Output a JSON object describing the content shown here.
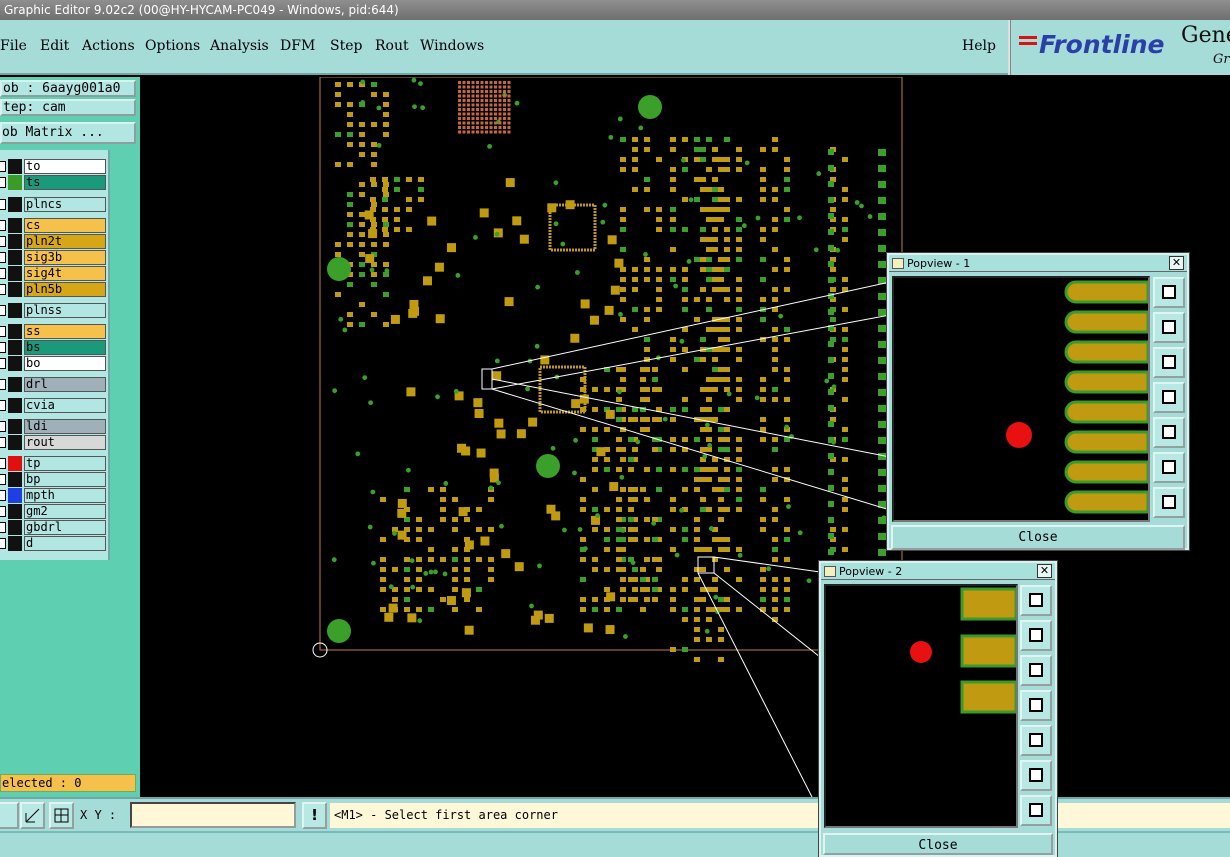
{
  "window_title": "Graphic Editor 9.02c2 (00@HY-HYCAM-PC049 - Windows, pid:644)",
  "menu": [
    "File",
    "Edit",
    "Actions",
    "Options",
    "Analysis",
    "DFM",
    "Step",
    "Rout",
    "Windows"
  ],
  "help_label": "Help",
  "brand": {
    "name": "Frontline",
    "product_line1": "Gene",
    "product_line2": "Grap"
  },
  "job_label": "ob  : 6aayg001a0",
  "step_label": "tep: cam",
  "matrix_button": "ob Matrix ...",
  "layers": [
    {
      "name": "to",
      "color": "#ffffff",
      "swatch": "#111111"
    },
    {
      "name": "ts",
      "color": "#1a9a7a",
      "swatch": "#3a9a2a"
    },
    {
      "name": "plncs",
      "color": "#b2e6e2",
      "swatch": "#111111"
    },
    {
      "name": "cs",
      "color": "#f6c14a",
      "swatch": "#111111"
    },
    {
      "name": "pln2t",
      "color": "#d6a616",
      "swatch": "#111111"
    },
    {
      "name": "sig3b",
      "color": "#f6c14a",
      "swatch": "#111111"
    },
    {
      "name": "sig4t",
      "color": "#f6c14a",
      "swatch": "#111111"
    },
    {
      "name": "pln5b",
      "color": "#d6a616",
      "swatch": "#111111"
    },
    {
      "name": "plnss",
      "color": "#b2e6e2",
      "swatch": "#111111"
    },
    {
      "name": "ss",
      "color": "#f6c14a",
      "swatch": "#111111"
    },
    {
      "name": "bs",
      "color": "#1a9a7a",
      "swatch": "#111111"
    },
    {
      "name": "bo",
      "color": "#ffffff",
      "swatch": "#111111"
    },
    {
      "name": "drl",
      "color": "#9fb0b8",
      "swatch": "#111111"
    },
    {
      "name": "cvia",
      "color": "#b2e6e2",
      "swatch": "#111111"
    },
    {
      "name": "ldi",
      "color": "#9fb0b8",
      "swatch": "#111111"
    },
    {
      "name": "rout",
      "color": "#d8d8d8",
      "swatch": "#111111"
    },
    {
      "name": "tp",
      "color": "#b2e6e2",
      "swatch": "#e01010"
    },
    {
      "name": "bp",
      "color": "#b2e6e2",
      "swatch": "#111111"
    },
    {
      "name": "mpth",
      "color": "#b2e6e2",
      "swatch": "#1f3fe0"
    },
    {
      "name": "gm2",
      "color": "#b2e6e2",
      "swatch": "#111111"
    },
    {
      "name": "gbdrl",
      "color": "#b2e6e2",
      "swatch": "#111111"
    },
    {
      "name": "d",
      "color": "#b2e6e2",
      "swatch": "#111111"
    }
  ],
  "selected_label": "elected : 0",
  "xy_label": "X Y :",
  "xy_value": "",
  "prompt": "<M1> - Select first area corner",
  "popview1": {
    "title": "Popview - 1",
    "close_label": "Close"
  },
  "popview2": {
    "title": "Popview - 2",
    "close_label": "Close"
  },
  "colors": {
    "pad": "#c09a10",
    "pad_outline": "#3a9a2a",
    "via": "#3aa02a",
    "testpoint": "#e81010",
    "panel": "#a6dcd8"
  }
}
